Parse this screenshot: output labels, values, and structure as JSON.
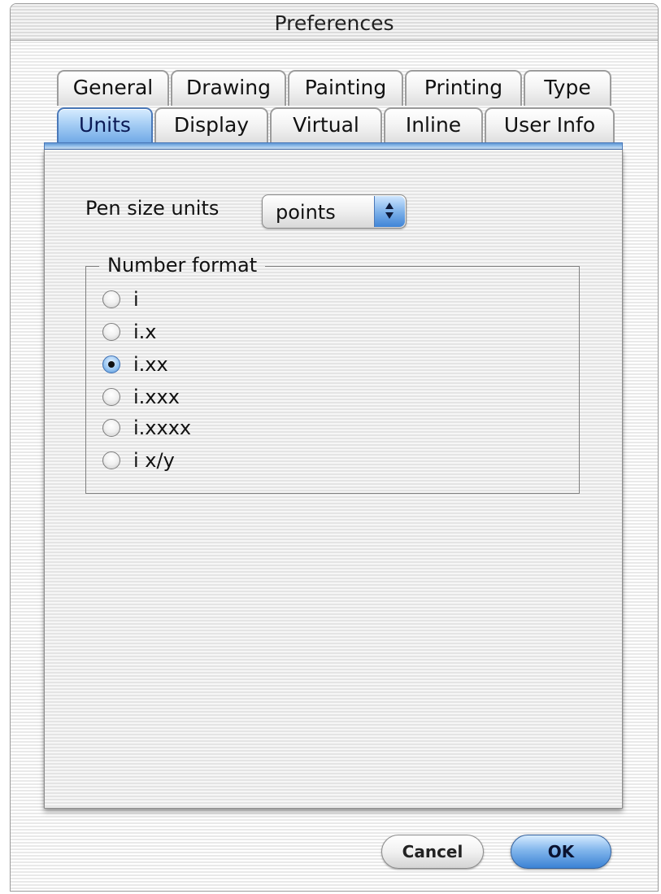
{
  "window": {
    "title": "Preferences"
  },
  "tabs": {
    "row1": [
      "General",
      "Drawing",
      "Painting",
      "Printing",
      "Type"
    ],
    "row2": [
      "Units",
      "Display",
      "Virtual",
      "Inline",
      "User Info"
    ],
    "selected": "Units"
  },
  "pen_size": {
    "label": "Pen size units",
    "value": "points",
    "arrows_icon": "up-down-arrows-icon"
  },
  "number_format": {
    "title": "Number format",
    "options": [
      "i",
      "i.x",
      "i.xx",
      "i.xxx",
      "i.xxxx",
      "i x/y"
    ],
    "selected": "i.xx"
  },
  "buttons": {
    "cancel": "Cancel",
    "ok": "OK"
  },
  "colors": {
    "accent_blue": "#6fa8e6",
    "default_button_blue": "#3b82d4"
  }
}
